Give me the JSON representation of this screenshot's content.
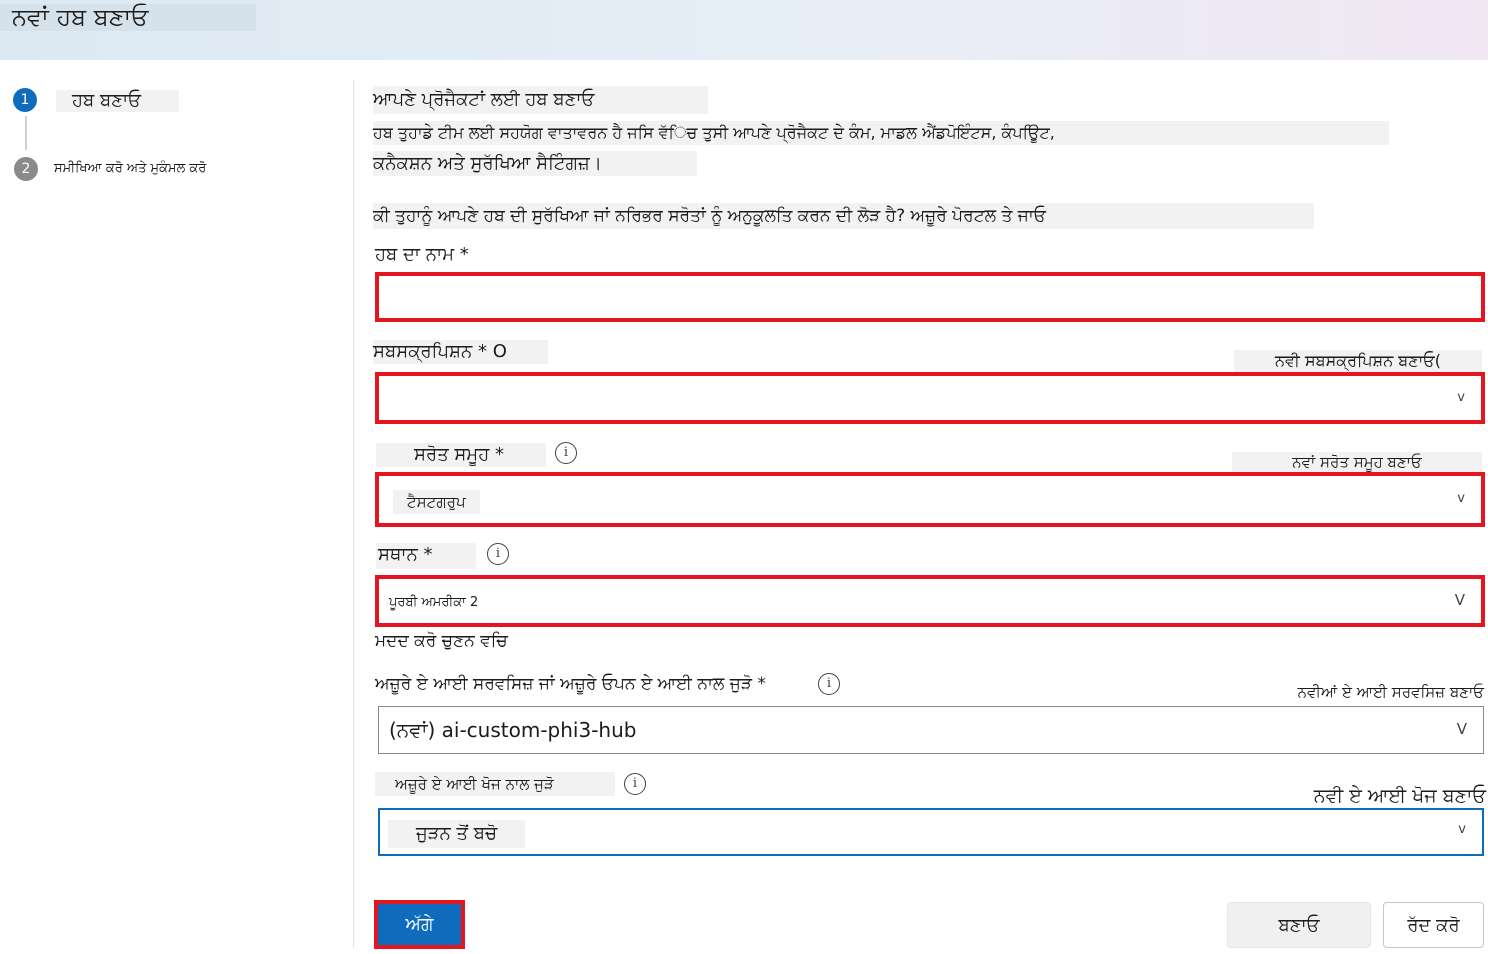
{
  "header": {
    "title": "ਨਵਾਂ ਹਬ ਬਣਾਓ"
  },
  "steps": [
    {
      "number": "1",
      "label": "ਹਬ ਬਣਾਓ",
      "active": true
    },
    {
      "number": "2",
      "label": "ਸਮੀਖਿਆ ਕਰੋ ਅਤੇ ਮੁਕੰਮਲ ਕਰੋ",
      "active": false
    }
  ],
  "intro": {
    "title": "ਆਪਣੇ ਪ੍ਰੋਜੈਕਟਾਂ ਲਈ ਹਬ ਬਣਾਓ",
    "line1": "ਹਬ ਤੁਹਾਡੇ ਟੀਮ ਲਈ ਸਹਯੋਗ ਵਾਤਾਵਰਨ ਹੈ ਜਸਿ ਵੱਿਚ ਤੁਸੀ ਆਪਣੇ ਪ੍ਰੋਜੈਕਟ ਦੇ ਕੰਮ, ਮਾਡਲ ਐਂਡਪੋਇੰਟਸ, ਕੰਪਊਿਟ,",
    "line2": "ਕਨੈਕਸ਼ਨ ਅਤੇ ਸੁਰੱਖਿਆ ਸੈਟਿੰਗਜ਼।",
    "portal_text": "ਕੀ ਤੁਹਾਨੂੰ ਆਪਣੇ ਹਬ ਦੀ ਸੁਰੱਖਿਆ ਜਾਂ ਨਰਿਭਰ ਸਰੋਤਾਂ ਨੂੰ ਅਨੁਕੂਲਤਿ ਕਰਨ ਦੀ ਲੋੜ ਹੈ? ਅਜ਼ੂਰੇ ਪੋਰਟਲ ਤੇ ਜਾਓ"
  },
  "form": {
    "hub_name": {
      "label": "ਹਬ ਦਾ ਨਾਮ *",
      "value": ""
    },
    "subscription": {
      "label": "ਸਬਸਕ੍ਰਪਿਸ਼ਨ * O",
      "value": "",
      "create_link": "ਨਵੀ ਸਬਸਕ੍ਰਪਿਸ਼ਨ ਬਣਾਓ("
    },
    "resource_group": {
      "label": "ਸਰੋਤ ਸਮੂਹ *",
      "value": "ਟੈਸਟਗਰੁਪ",
      "create_link": "ਨਵਾਂ ਸਰੋਤ ਸਮੂਹ ਬਣਾਓ"
    },
    "location": {
      "label": "ਸਥਾਨ *",
      "value": "ਪੂਰਬੀ ਅਮਰੀਕਾ 2",
      "help": "ਮਦਦ ਕਰੋ ਚੁਣਨ ਵਚਿ"
    },
    "ai_services": {
      "label": "ਅਜ਼ੂਰੇ ਏ ਆਈ ਸਰਵਸਿਜ਼ ਜਾਂ ਅਜ਼ੂਰੇ ਓਪਨ ਏ ਆਈ ਨਾਲ ਜੁੜੋ *",
      "value": "(ਨਵਾਂ) ai-custom-phi3-hub",
      "create_link": "ਨਵੀਆਂ ਏ ਆਈ ਸਰਵਸਿਜ਼ ਬਣਾਓ"
    },
    "ai_search": {
      "label": "ਅਜ਼ੂਰੇ ਏ ਆਈ ਖੋਜ ਨਾਲ ਜੁੜੋ",
      "value": "ਜੁੜਨ ਤੋਂ ਬਚੋ",
      "create_link": "ਨਵੀ ਏ ਆਈ ਖੋਜ ਬਣਾਓ"
    }
  },
  "icons": {
    "info": "i",
    "chevron": "v",
    "chevron_large": "V"
  },
  "buttons": {
    "next": "ਅੱਗੇ",
    "create": "ਬਣਾਓ",
    "cancel": "ਰੱਦ ਕਰੋ"
  },
  "colors": {
    "accent": "#0f6cbd",
    "highlight": "#e3151f",
    "step_inactive": "#8a8a8a"
  }
}
